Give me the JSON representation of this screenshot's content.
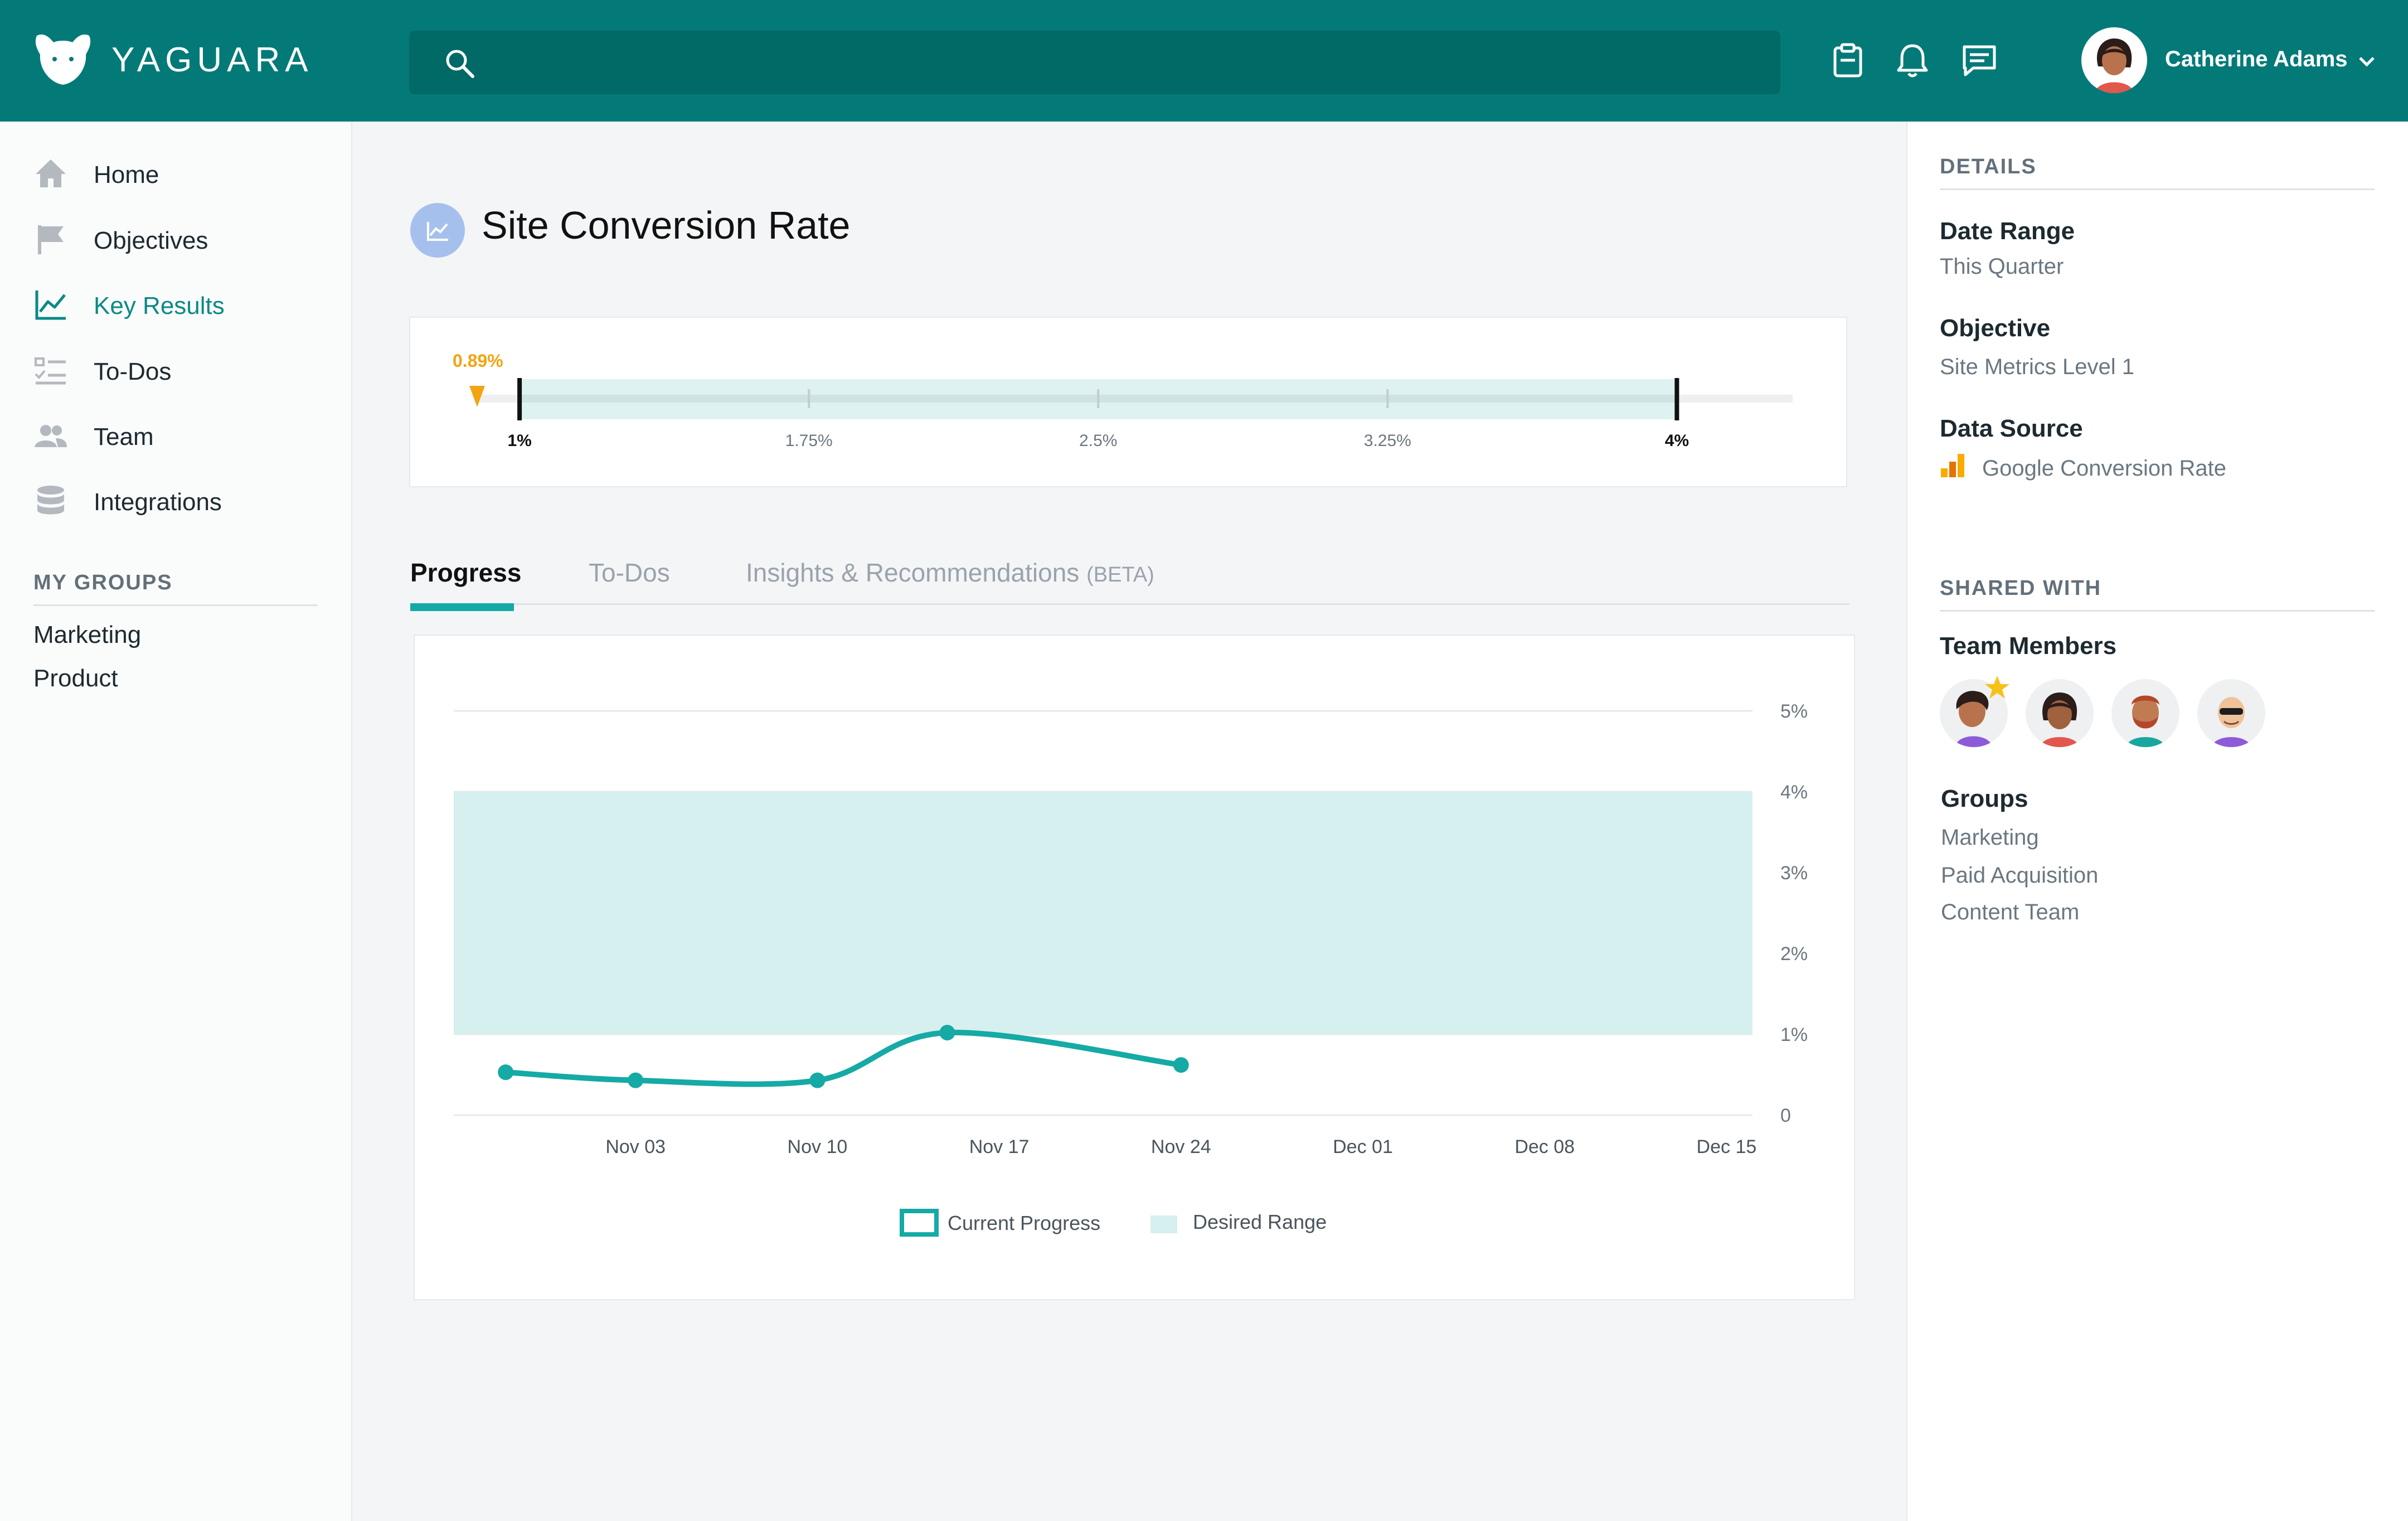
{
  "app": {
    "brand": "YAGUARA"
  },
  "header": {
    "search_placeholder": "",
    "user_name": "Catherine Adams",
    "icons": [
      "clipboard-icon",
      "bell-icon",
      "chat-icon"
    ]
  },
  "sidebar": {
    "items": [
      {
        "label": "Home",
        "icon": "home-icon",
        "active": false
      },
      {
        "label": "Objectives",
        "icon": "flag-icon",
        "active": false
      },
      {
        "label": "Key Results",
        "icon": "line-chart-icon",
        "active": true
      },
      {
        "label": "To-Dos",
        "icon": "checklist-icon",
        "active": false
      },
      {
        "label": "Team",
        "icon": "team-icon",
        "active": false
      },
      {
        "label": "Integrations",
        "icon": "database-icon",
        "active": false
      }
    ],
    "groups_title": "MY GROUPS",
    "groups": [
      "Marketing",
      "Product"
    ]
  },
  "main": {
    "title": "Site Conversion Rate",
    "range": {
      "current_label": "0.89%",
      "current_value": 0.89,
      "min": 0.89,
      "max": 4.3,
      "ticks": [
        {
          "label": "1%",
          "value": 1,
          "bold": true
        },
        {
          "label": "1.75%",
          "value": 1.75,
          "bold": false
        },
        {
          "label": "2.5%",
          "value": 2.5,
          "bold": false
        },
        {
          "label": "3.25%",
          "value": 3.25,
          "bold": false
        },
        {
          "label": "4%",
          "value": 4,
          "bold": true
        }
      ],
      "desired": [
        1,
        4
      ]
    },
    "tabs": [
      {
        "label": "Progress",
        "active": true
      },
      {
        "label": "To-Dos",
        "active": false
      },
      {
        "label": "Insights & Recommendations",
        "suffix": "(BETA)",
        "active": false
      }
    ]
  },
  "chart_data": {
    "type": "line",
    "x_ticks": [
      "Nov 03",
      "Nov 10",
      "Nov 17",
      "Nov 24",
      "Dec 01",
      "Dec 08",
      "Dec 15"
    ],
    "y_ticks": [
      "0",
      "1%",
      "2%",
      "3%",
      "4%",
      "5%"
    ],
    "ylim": [
      0,
      5
    ],
    "xlim": [
      "Oct 27",
      "Dec 16"
    ],
    "series": [
      {
        "name": "Current Progress",
        "x": [
          "Oct 29",
          "Nov 03",
          "Nov 10",
          "Nov 15",
          "Nov 24"
        ],
        "y": [
          0.53,
          0.43,
          0.43,
          1.02,
          0.62
        ]
      }
    ],
    "desired_range": {
      "name": "Desired Range",
      "from": 1,
      "to": 4
    },
    "legend": [
      "Current Progress",
      "Desired Range"
    ],
    "grid": true,
    "colors": {
      "line": "#15aaa5",
      "band": "#d6f0ef"
    }
  },
  "details": {
    "title": "DETAILS",
    "date_range_label": "Date Range",
    "date_range_value": "This Quarter",
    "objective_label": "Objective",
    "objective_value": "Site Metrics Level 1",
    "data_source_label": "Data Source",
    "data_source_value": "Google Conversion Rate"
  },
  "shared": {
    "title": "SHARED WITH",
    "members_label": "Team Members",
    "members": [
      "member-1",
      "member-2",
      "member-3",
      "member-4"
    ],
    "groups_label": "Groups",
    "groups": [
      "Marketing",
      "Paid Acquisition",
      "Content Team"
    ]
  },
  "colors": {
    "header": "#037a78",
    "accent": "#13aaa5",
    "orange": "#f2a413"
  }
}
